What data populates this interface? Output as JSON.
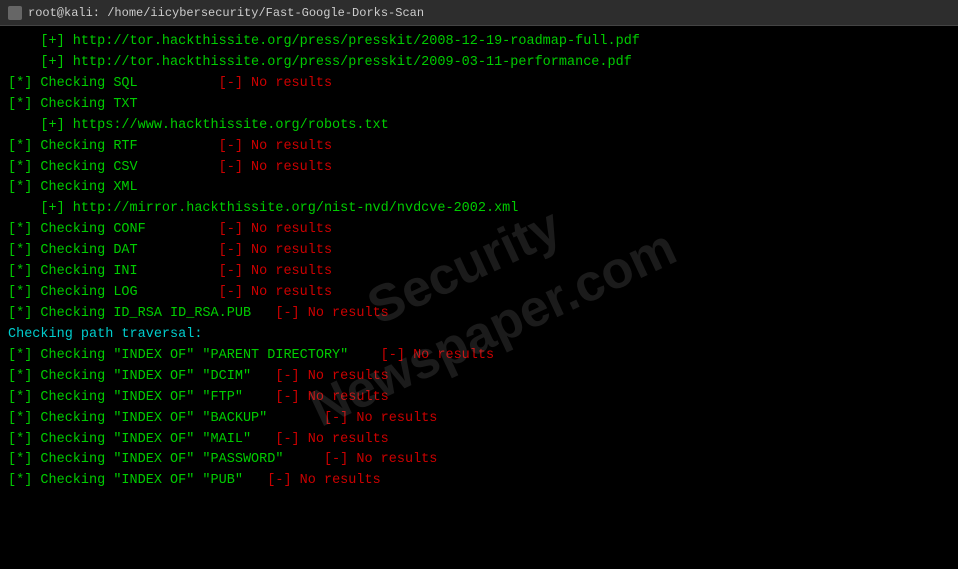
{
  "titleBar": {
    "icon": "terminal-icon",
    "title": "root@kali: /home/iicybersecurity/Fast-Google-Dorks-Scan"
  },
  "terminal": {
    "lines": [
      {
        "parts": [
          {
            "text": "    [+] http://tor.hackthissite.org/press/presskit/2008-12-19-roadmap-full.pdf",
            "color": "green"
          }
        ]
      },
      {
        "parts": [
          {
            "text": "    [+] http://tor.hackthissite.org/press/presskit/2009-03-11-performance.pdf",
            "color": "green"
          }
        ]
      },
      {
        "parts": [
          {
            "text": "[*] ",
            "color": "green"
          },
          {
            "text": "Checking SQL",
            "color": "green"
          },
          {
            "text": "          [-] No results",
            "color": "red"
          }
        ]
      },
      {
        "parts": [
          {
            "text": "[*] ",
            "color": "green"
          },
          {
            "text": "Checking TXT",
            "color": "green"
          }
        ]
      },
      {
        "parts": [
          {
            "text": "    [+] https://www.hackthissite.org/robots.txt",
            "color": "green"
          }
        ]
      },
      {
        "parts": [
          {
            "text": "[*] ",
            "color": "green"
          },
          {
            "text": "Checking RTF",
            "color": "green"
          },
          {
            "text": "          [-] No results",
            "color": "red"
          }
        ]
      },
      {
        "parts": [
          {
            "text": "[*] ",
            "color": "green"
          },
          {
            "text": "Checking CSV",
            "color": "green"
          },
          {
            "text": "          [-] No results",
            "color": "red"
          }
        ]
      },
      {
        "parts": [
          {
            "text": "[*] ",
            "color": "green"
          },
          {
            "text": "Checking XML",
            "color": "green"
          }
        ]
      },
      {
        "parts": [
          {
            "text": "    [+] http://mirror.hackthissite.org/nist-nvd/nvdcve-2002.xml",
            "color": "green"
          }
        ]
      },
      {
        "parts": [
          {
            "text": "[*] ",
            "color": "green"
          },
          {
            "text": "Checking CONF",
            "color": "green"
          },
          {
            "text": "         [-] No results",
            "color": "red"
          }
        ]
      },
      {
        "parts": [
          {
            "text": "[*] ",
            "color": "green"
          },
          {
            "text": "Checking DAT",
            "color": "green"
          },
          {
            "text": "          [-] No results",
            "color": "red"
          }
        ]
      },
      {
        "parts": [
          {
            "text": "[*] ",
            "color": "green"
          },
          {
            "text": "Checking INI",
            "color": "green"
          },
          {
            "text": "          [-] No results",
            "color": "red"
          }
        ]
      },
      {
        "parts": [
          {
            "text": "[*] ",
            "color": "green"
          },
          {
            "text": "Checking LOG",
            "color": "green"
          },
          {
            "text": "          [-] No results",
            "color": "red"
          }
        ]
      },
      {
        "parts": [
          {
            "text": "[*] ",
            "color": "green"
          },
          {
            "text": "Checking ID_RSA ID_RSA.PUB",
            "color": "green"
          },
          {
            "text": "   [-] No results",
            "color": "red"
          }
        ]
      },
      {
        "parts": [
          {
            "text": "",
            "color": "white"
          }
        ]
      },
      {
        "parts": [
          {
            "text": "Checking path traversal:",
            "color": "cyan"
          }
        ]
      },
      {
        "parts": [
          {
            "text": "[*] ",
            "color": "green"
          },
          {
            "text": "Checking \"INDEX OF\" \"PARENT DIRECTORY\"",
            "color": "green"
          },
          {
            "text": "    [-] No results",
            "color": "red"
          }
        ]
      },
      {
        "parts": [
          {
            "text": "[*] ",
            "color": "green"
          },
          {
            "text": "Checking \"INDEX OF\" \"DCIM\"",
            "color": "green"
          },
          {
            "text": "   [-] No results",
            "color": "red"
          }
        ]
      },
      {
        "parts": [
          {
            "text": "[*] ",
            "color": "green"
          },
          {
            "text": "Checking \"INDEX OF\" \"FTP\"",
            "color": "green"
          },
          {
            "text": "    [-] No results",
            "color": "red"
          }
        ]
      },
      {
        "parts": [
          {
            "text": "[*] ",
            "color": "green"
          },
          {
            "text": "Checking \"INDEX OF\" \"BACKUP\"",
            "color": "green"
          },
          {
            "text": "       [-] No results",
            "color": "red"
          }
        ]
      },
      {
        "parts": [
          {
            "text": "[*] ",
            "color": "green"
          },
          {
            "text": "Checking \"INDEX OF\" \"MAIL\"",
            "color": "green"
          },
          {
            "text": "   [-] No results",
            "color": "red"
          }
        ]
      },
      {
        "parts": [
          {
            "text": "[*] ",
            "color": "green"
          },
          {
            "text": "Checking \"INDEX OF\" \"PASSWORD\"",
            "color": "green"
          },
          {
            "text": "     [-] No results",
            "color": "red"
          }
        ]
      },
      {
        "parts": [
          {
            "text": "[*] ",
            "color": "green"
          },
          {
            "text": "Checking \"INDEX OF\" \"PUB\"",
            "color": "green"
          },
          {
            "text": "   [-] No results",
            "color": "red"
          }
        ]
      }
    ]
  },
  "watermark": {
    "line1": "Security",
    "line2": "Newspaper.com"
  }
}
